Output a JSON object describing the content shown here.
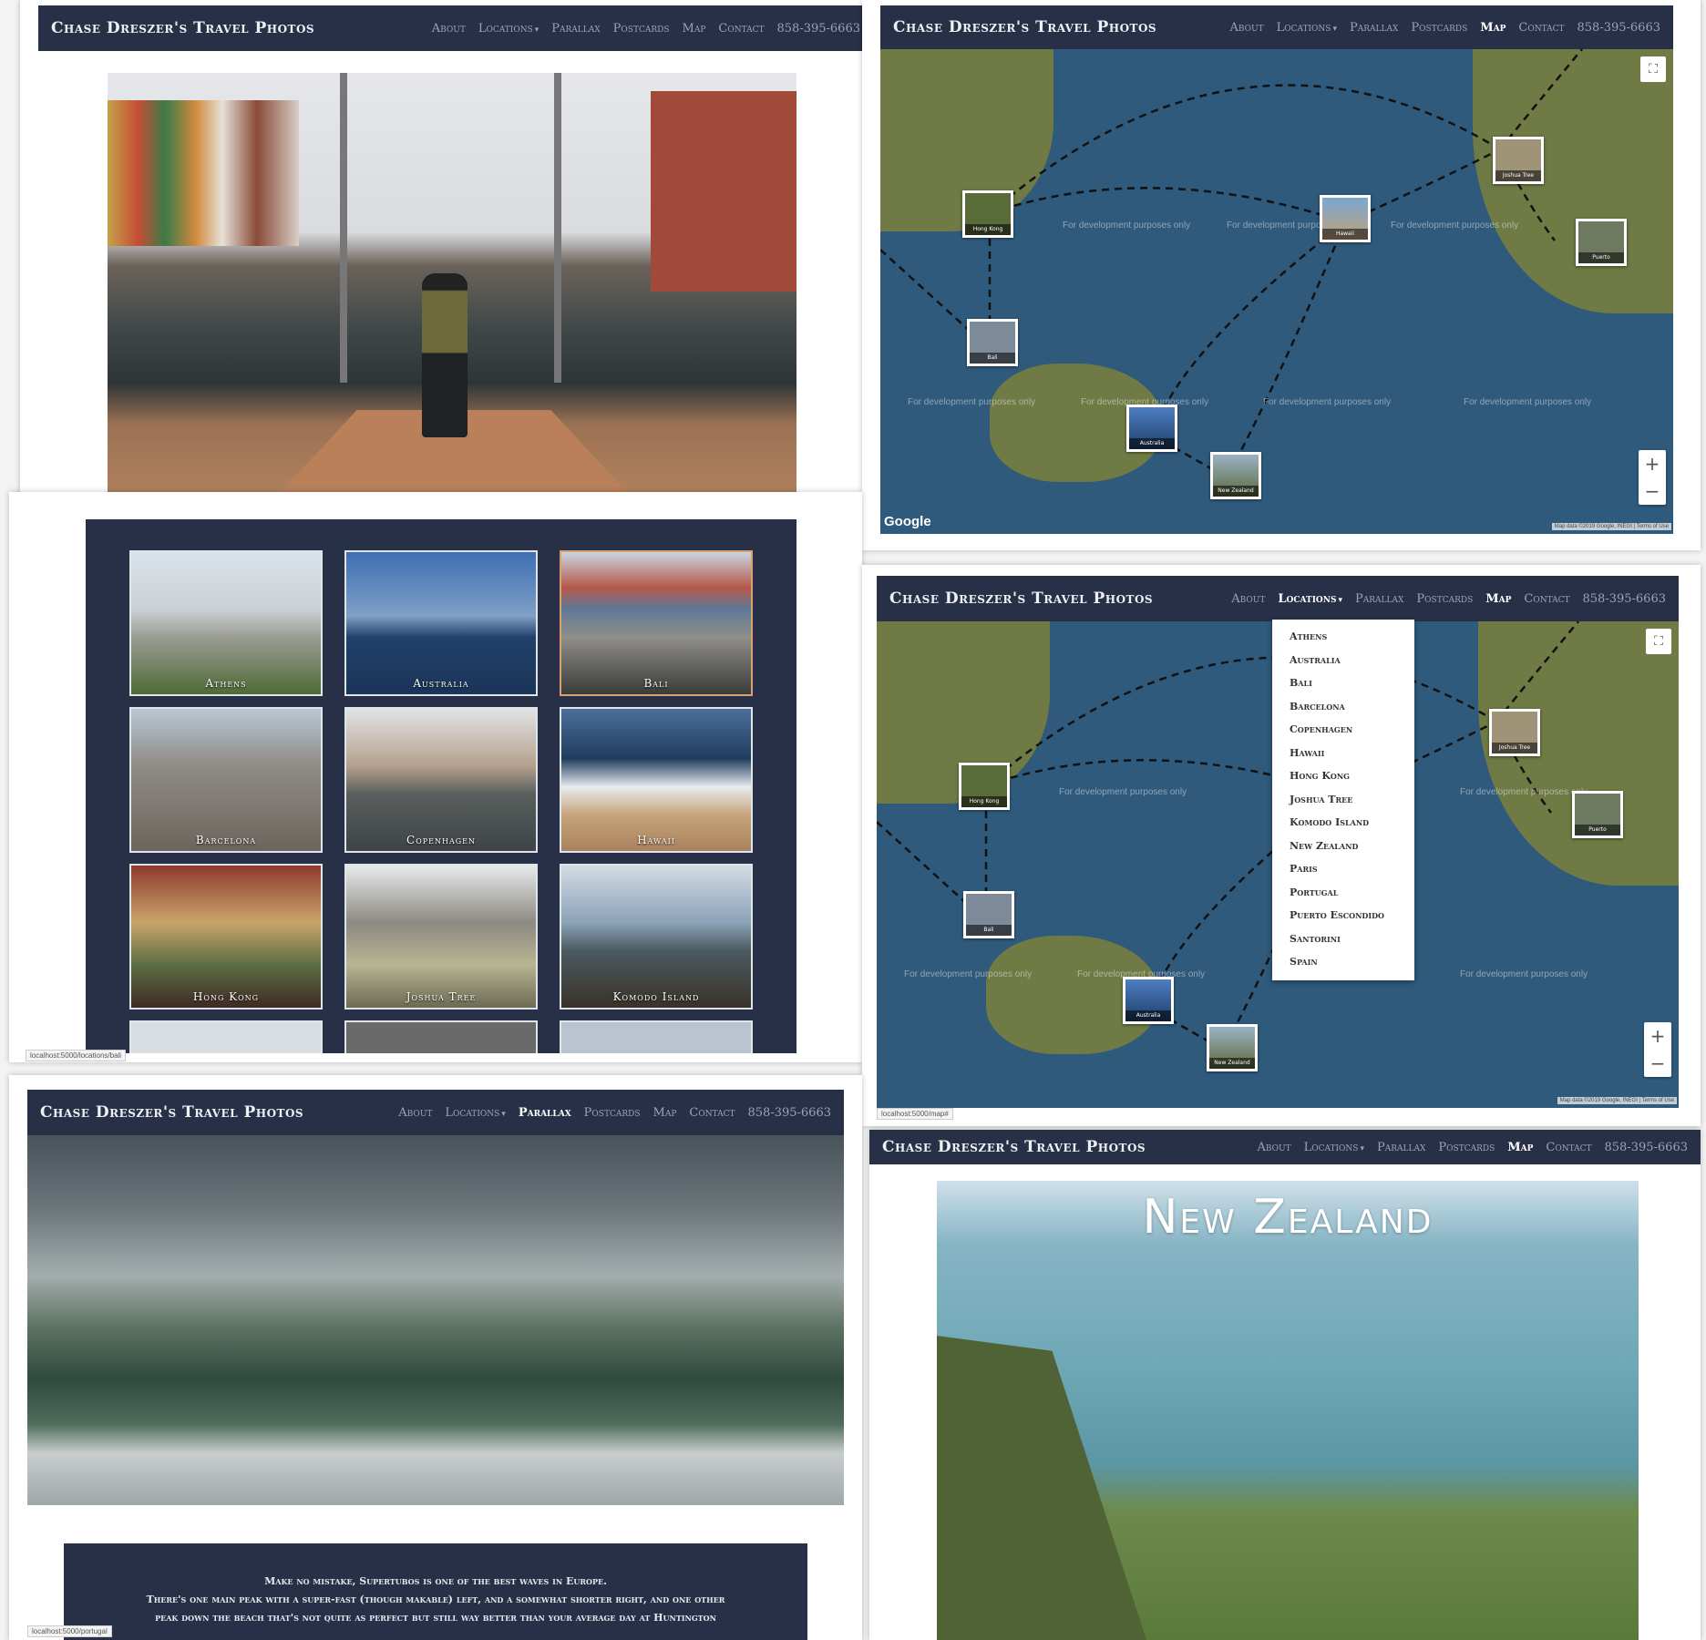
{
  "site": {
    "brand": "Chase Dreszer's Travel Photos",
    "nav": {
      "about": "About",
      "locations": "Locations",
      "parallax": "Parallax",
      "postcards": "Postcards",
      "map": "Map",
      "contact": "Contact",
      "phone": "858-395-6663"
    }
  },
  "map": {
    "dev_watermark": "For development purposes only",
    "google_logo": "Google",
    "attribution": "Map data ©2019 Google, INEGI | Terms of Use",
    "zoom_in": "+",
    "zoom_out": "−",
    "fullscreen_icon": "⛶",
    "markers": [
      "Hong Kong",
      "Bali",
      "Hawaii",
      "Joshua Tree",
      "Puerto Escondido",
      "Australia",
      "New Zealand"
    ]
  },
  "gallery": {
    "tiles": [
      "Athens",
      "Australia",
      "Bali",
      "Barcelona",
      "Copenhagen",
      "Hawaii",
      "Hong Kong",
      "Joshua Tree",
      "Komodo Island"
    ]
  },
  "dropdown": {
    "items": [
      "Athens",
      "Australia",
      "Bali",
      "Barcelona",
      "Copenhagen",
      "Hawaii",
      "Hong Kong",
      "Joshua Tree",
      "Komodo Island",
      "New Zealand",
      "Paris",
      "Portugal",
      "Puerto Escondido",
      "Santorini",
      "Spain"
    ]
  },
  "parallax": {
    "lines": [
      "Make no mistake, Supertubos is one of the best waves in Europe.",
      "There's one main peak with a super-fast (though makable) left, and a somewhat shorter right, and one other",
      "peak down the beach that's not quite as perfect but still way better than your average day at Huntington"
    ]
  },
  "new_zealand": {
    "title": "New Zealand"
  },
  "status_urls": {
    "gallery": "localhost:5000/locations/bali",
    "map": "localhost:5000/map#",
    "parallax": "localhost:5000/portugal"
  },
  "colors": {
    "navbar": "#283048",
    "ocean": "#2f5a7c",
    "land": "#6f7a45"
  }
}
